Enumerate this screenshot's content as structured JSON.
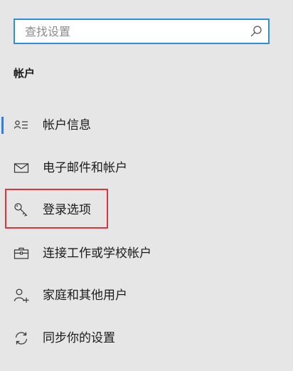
{
  "search": {
    "placeholder": "查找设置"
  },
  "section": {
    "title": "帐户"
  },
  "nav": {
    "items": [
      {
        "label": "帐户信息",
        "icon": "account-info-icon",
        "selected": true
      },
      {
        "label": "电子邮件和帐户",
        "icon": "mail-icon",
        "selected": false
      },
      {
        "label": "登录选项",
        "icon": "key-icon",
        "selected": false
      },
      {
        "label": "连接工作或学校帐户",
        "icon": "briefcase-icon",
        "selected": false
      },
      {
        "label": "家庭和其他用户",
        "icon": "add-user-icon",
        "selected": false
      },
      {
        "label": "同步你的设置",
        "icon": "sync-icon",
        "selected": false
      }
    ]
  },
  "annotation": {
    "highlight_color": "#e0333a",
    "highlighted_item": "登录选项"
  },
  "colors": {
    "accent": "#2f8fd8",
    "background": "#e6e6e6"
  }
}
